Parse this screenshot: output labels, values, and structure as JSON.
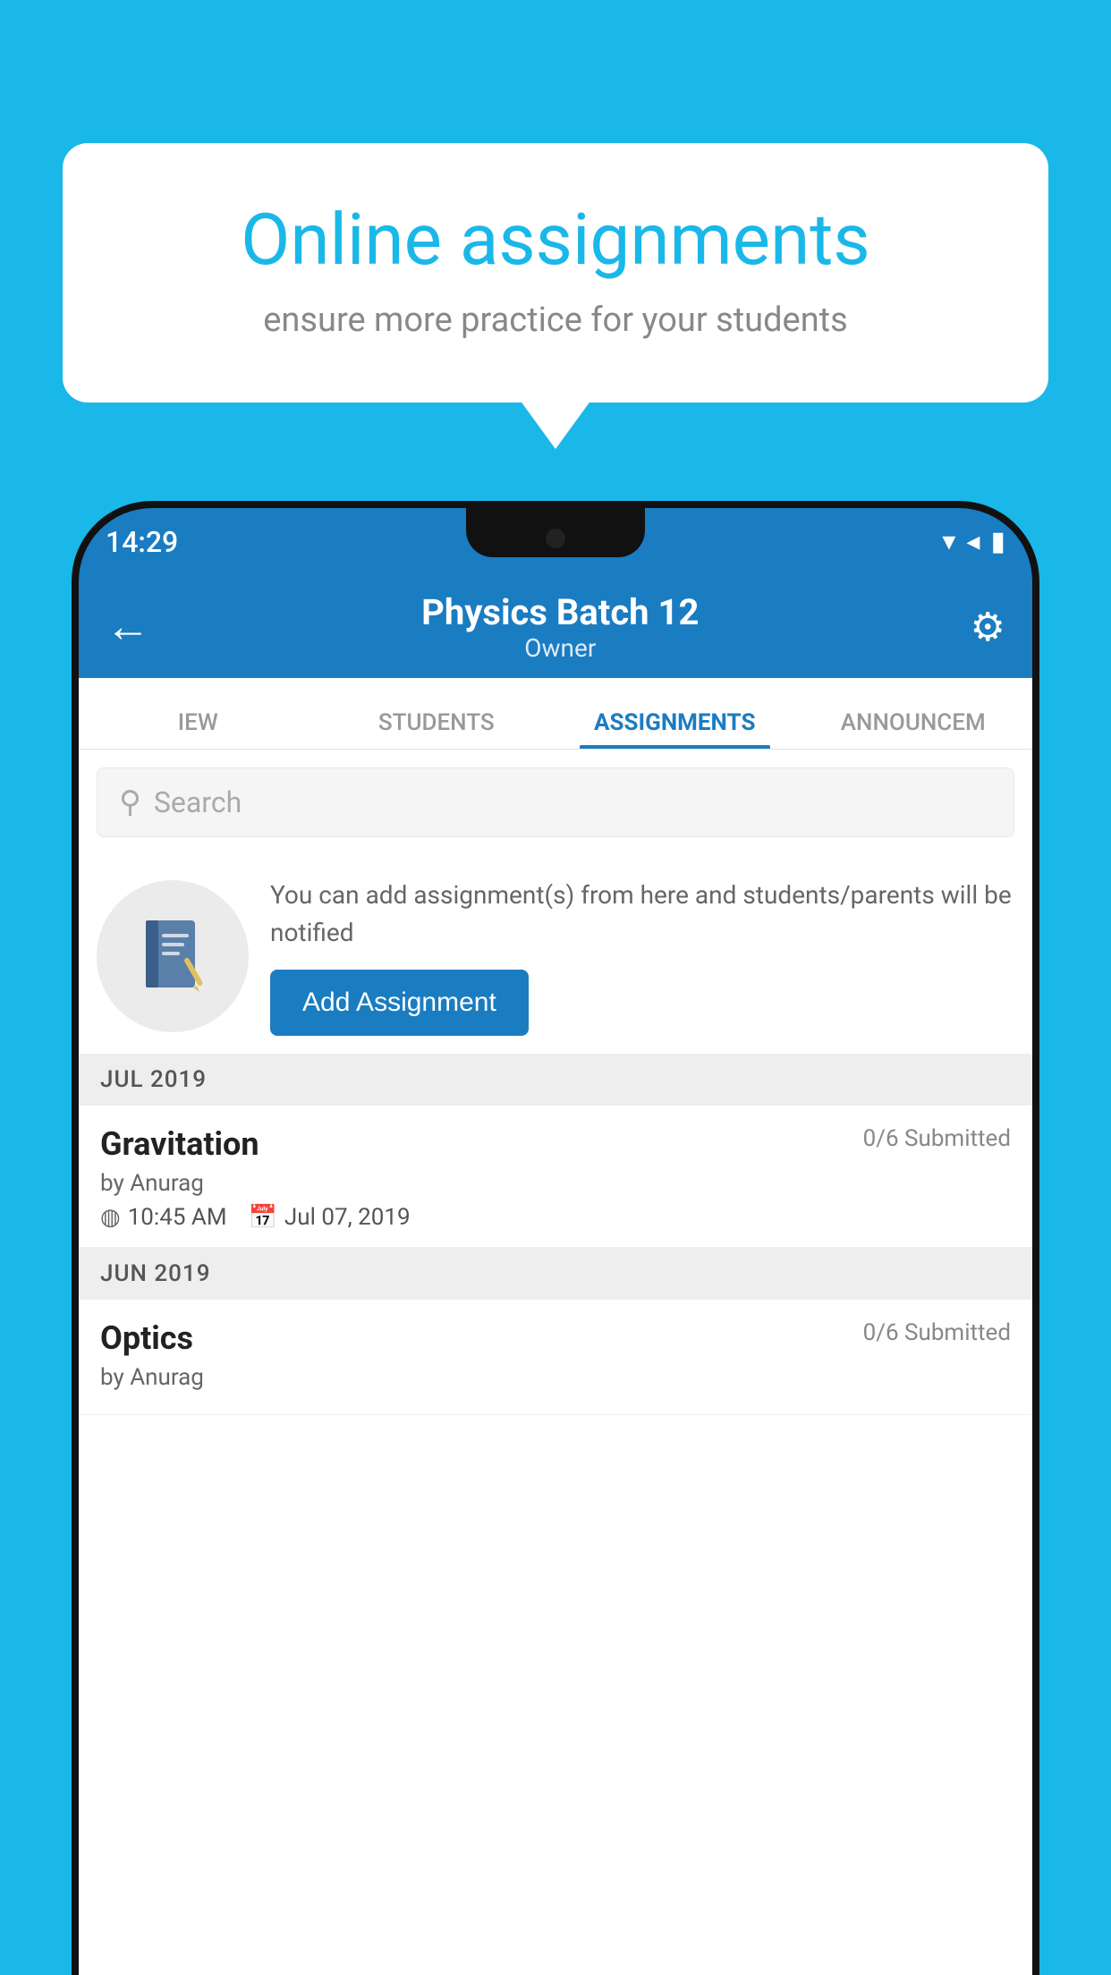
{
  "background": {
    "color": "#1ab8e8"
  },
  "speech_bubble": {
    "title": "Online assignments",
    "subtitle": "ensure more practice for your students"
  },
  "status_bar": {
    "time": "14:29",
    "wifi": "▼",
    "signal": "▲",
    "battery": "▮"
  },
  "header": {
    "title": "Physics Batch 12",
    "subtitle": "Owner",
    "back_label": "←",
    "settings_label": "⚙"
  },
  "tabs": [
    {
      "label": "IEW",
      "active": false
    },
    {
      "label": "STUDENTS",
      "active": false
    },
    {
      "label": "ASSIGNMENTS",
      "active": true
    },
    {
      "label": "ANNOUNCEM",
      "active": false
    }
  ],
  "search": {
    "placeholder": "Search"
  },
  "empty_state": {
    "description": "You can add assignment(s) from here and students/parents will be notified",
    "button_label": "Add Assignment",
    "icon": "📓"
  },
  "sections": [
    {
      "label": "JUL 2019",
      "assignments": [
        {
          "title": "Gravitation",
          "submitted": "0/6 Submitted",
          "by": "by Anurag",
          "time": "10:45 AM",
          "date": "Jul 07, 2019"
        }
      ]
    },
    {
      "label": "JUN 2019",
      "assignments": [
        {
          "title": "Optics",
          "submitted": "0/6 Submitted",
          "by": "by Anurag",
          "time": "",
          "date": ""
        }
      ]
    }
  ]
}
